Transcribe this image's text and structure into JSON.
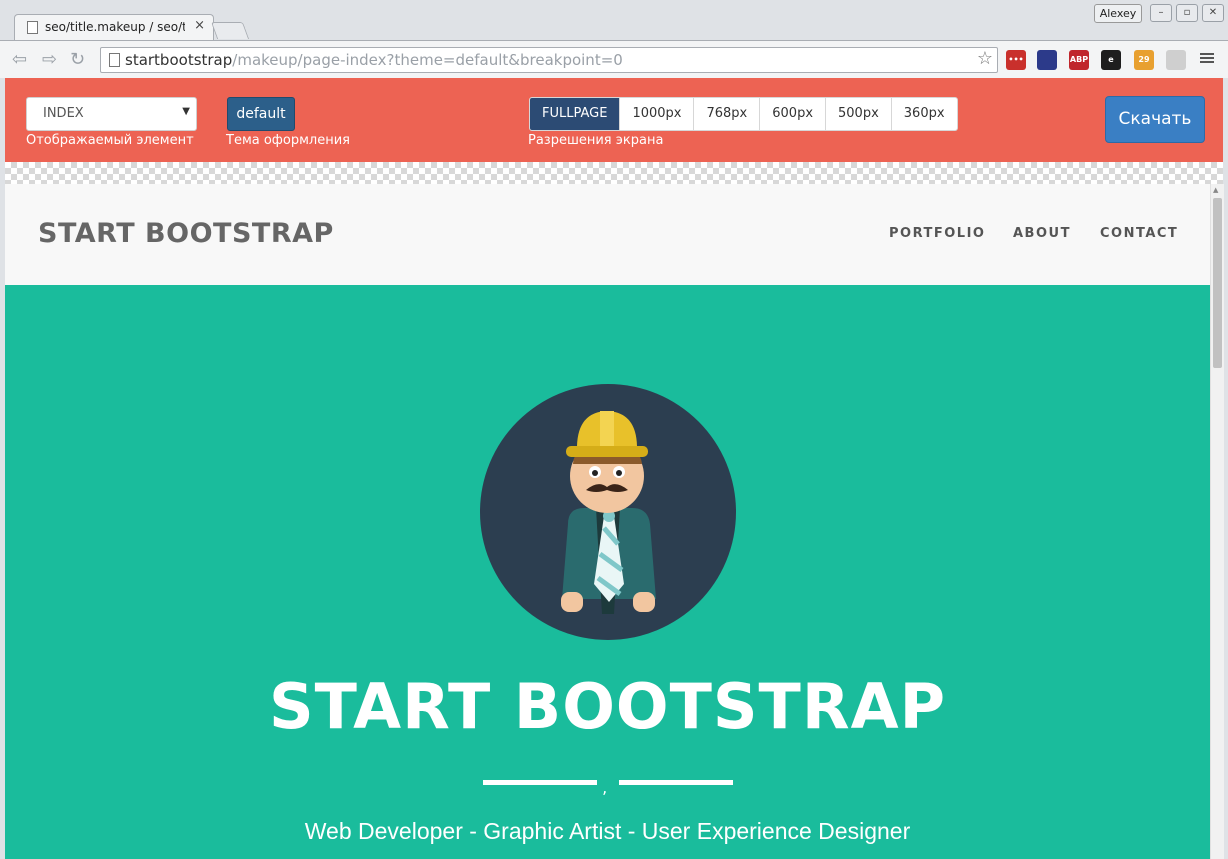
{
  "browser": {
    "tab_title": "seo/title.makeup / seo/title",
    "tab_close": "×",
    "user_name": "Alexey",
    "url_host": "startbootstrap",
    "url_path": "/makeup/page-index?theme=default&breakpoint=0",
    "star_glyph": "☆",
    "extensions": [
      {
        "name": "lastpass-extension",
        "color": "#c9302c",
        "label": "•••"
      },
      {
        "name": "extension-2",
        "color": "#2c3a8a",
        "label": ""
      },
      {
        "name": "adblock-extension",
        "color": "#c0262c",
        "label": "ABP"
      },
      {
        "name": "extension-4",
        "color": "#1e1e1e",
        "label": "e"
      },
      {
        "name": "extension-5",
        "color": "#e8a030",
        "label": "29"
      },
      {
        "name": "extension-6",
        "color": "#cfcfcf",
        "label": ""
      }
    ]
  },
  "controls": {
    "element_select_value": "INDEX",
    "element_label": "Отображаемый элемент",
    "theme_button": "default",
    "theme_label": "Тема оформления",
    "breakpoints": [
      "FULLPAGE",
      "1000px",
      "768px",
      "600px",
      "500px",
      "360px"
    ],
    "breakpoints_label": "Разрешения экрана",
    "download_button": "Скачать"
  },
  "site": {
    "brand": "START BOOTSTRAP",
    "nav": [
      "PORTFOLIO",
      "ABOUT",
      "CONTACT"
    ],
    "hero_title": "START BOOTSTRAP",
    "hero_divider_glyph": "‚",
    "hero_subtitle": "Web Developer - Graphic Artist - User Experience Designer"
  },
  "colors": {
    "control_bar": "#ed6353",
    "hero_bg": "#1abc9c",
    "avatar_bg": "#2c3e50",
    "download_btn": "#3a7fc4"
  }
}
